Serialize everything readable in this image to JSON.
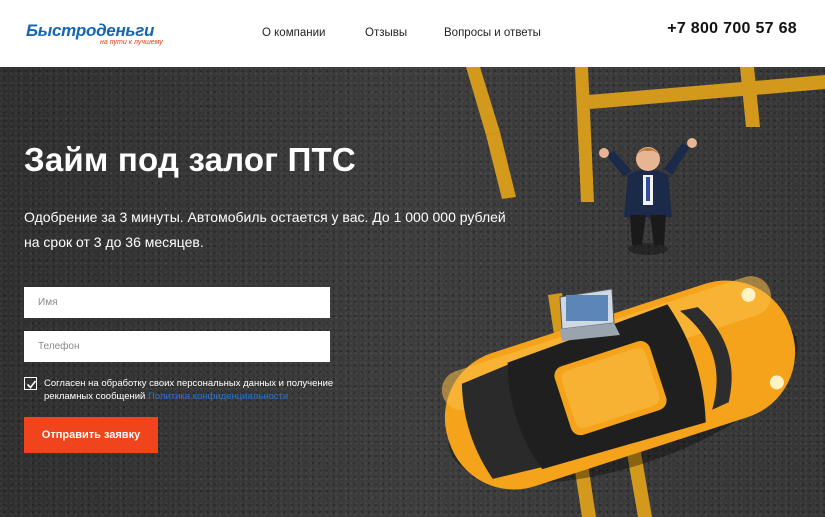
{
  "header": {
    "logo_text": "Быстроденьги",
    "logo_tagline": "на пути к лучшему",
    "nav": [
      {
        "label": "О компании"
      },
      {
        "label": "Отзывы"
      },
      {
        "label": "Вопросы и ответы"
      }
    ],
    "phone": "+7 800 700 57 68"
  },
  "hero": {
    "title": "Займ под залог ПТС",
    "subtitle": "Одобрение за 3 минуты. Автомобиль остается у вас. До 1 000 000 рублей на срок от 3 до 36 месяцев.",
    "form": {
      "name_placeholder": "Имя",
      "phone_placeholder": "Телефон",
      "consent_checked": true,
      "consent_text": "Согласен на обработку своих персональных данных и получение рекламных сообщений",
      "consent_link": "Политика конфиденциальности",
      "submit_label": "Отправить заявку"
    }
  },
  "colors": {
    "brand_blue": "#1565b5",
    "accent_red": "#f0441d",
    "road_marking": "#e0a21a",
    "car_body": "#f4a31a"
  }
}
